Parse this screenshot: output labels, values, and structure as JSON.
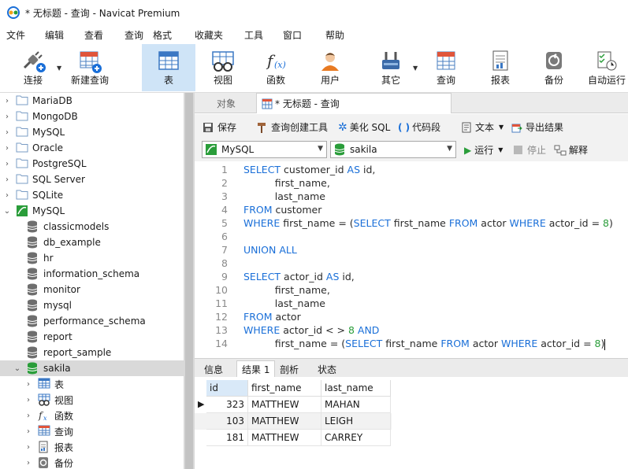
{
  "window": {
    "title": "* 无标题 - 查询 - Navicat Premium"
  },
  "menu": [
    "文件",
    "编辑",
    "查看",
    "查询",
    "格式",
    "收藏夹",
    "工具",
    "窗口",
    "帮助"
  ],
  "toolbar": {
    "items": [
      {
        "label": "连接",
        "icon": "connection-plug-icon"
      },
      {
        "label": "新建查询",
        "icon": "new-query-icon"
      },
      {
        "label": "表",
        "icon": "table-icon",
        "active": true
      },
      {
        "label": "视图",
        "icon": "view-icon"
      },
      {
        "label": "函数",
        "icon": "function-icon"
      },
      {
        "label": "用户",
        "icon": "user-icon"
      },
      {
        "label": "其它",
        "icon": "tools-icon"
      },
      {
        "label": "查询",
        "icon": "query-icon"
      },
      {
        "label": "报表",
        "icon": "report-icon"
      },
      {
        "label": "备份",
        "icon": "backup-icon"
      },
      {
        "label": "自动运行",
        "icon": "automation-icon"
      }
    ]
  },
  "sidebar": {
    "connections": [
      "MariaDB",
      "MongoDB",
      "MySQL",
      "Oracle",
      "PostgreSQL",
      "SQL Server",
      "SQLite"
    ],
    "open_connection": "MySQL",
    "databases": [
      "classicmodels",
      "db_example",
      "hr",
      "information_schema",
      "monitor",
      "mysql",
      "performance_schema",
      "report",
      "report_sample"
    ],
    "selected_db": "sakila",
    "children": [
      {
        "label": "表",
        "icon": "table-icon"
      },
      {
        "label": "视图",
        "icon": "view-icon"
      },
      {
        "label": "函数",
        "icon": "function-icon"
      },
      {
        "label": "查询",
        "icon": "query-icon"
      },
      {
        "label": "报表",
        "icon": "report-icon"
      },
      {
        "label": "备份",
        "icon": "backup-icon"
      }
    ]
  },
  "tabs": {
    "objects": "对象",
    "query": "* 无标题 - 查询"
  },
  "query_toolbar": {
    "save": "保存",
    "builder": "查询创建工具",
    "beautify": "美化 SQL",
    "snippet": "代码段",
    "text": "文本",
    "export": "导出结果",
    "run": "运行",
    "stop": "停止",
    "explain": "解释",
    "connection": "MySQL",
    "database": "sakila"
  },
  "editor": {
    "lines": [
      [
        {
          "t": "SELECT ",
          "k": "kw"
        },
        {
          "t": "customer_id ",
          "k": "id"
        },
        {
          "t": "AS ",
          "k": "kw"
        },
        {
          "t": "id,",
          "k": "id"
        }
      ],
      [
        {
          "t": "          first_name,",
          "k": "id"
        }
      ],
      [
        {
          "t": "          last_name",
          "k": "id"
        }
      ],
      [
        {
          "t": "FROM ",
          "k": "kw"
        },
        {
          "t": "customer",
          "k": "id"
        }
      ],
      [
        {
          "t": "WHERE ",
          "k": "kw"
        },
        {
          "t": "first_name = (",
          "k": "id"
        },
        {
          "t": "SELECT ",
          "k": "kw"
        },
        {
          "t": "first_name ",
          "k": "id"
        },
        {
          "t": "FROM ",
          "k": "kw"
        },
        {
          "t": "actor ",
          "k": "id"
        },
        {
          "t": "WHERE ",
          "k": "kw"
        },
        {
          "t": "actor_id = ",
          "k": "id"
        },
        {
          "t": "8",
          "k": "num"
        },
        {
          "t": ")",
          "k": "id"
        }
      ],
      [],
      [
        {
          "t": "UNION ALL",
          "k": "kw"
        }
      ],
      [],
      [
        {
          "t": "SELECT ",
          "k": "kw"
        },
        {
          "t": "actor_id ",
          "k": "id"
        },
        {
          "t": "AS ",
          "k": "kw"
        },
        {
          "t": "id,",
          "k": "id"
        }
      ],
      [
        {
          "t": "          first_name,",
          "k": "id"
        }
      ],
      [
        {
          "t": "          last_name",
          "k": "id"
        }
      ],
      [
        {
          "t": "FROM ",
          "k": "kw"
        },
        {
          "t": "actor",
          "k": "id"
        }
      ],
      [
        {
          "t": "WHERE ",
          "k": "kw"
        },
        {
          "t": "actor_id < > ",
          "k": "id"
        },
        {
          "t": "8 ",
          "k": "num"
        },
        {
          "t": "AND",
          "k": "kw"
        }
      ],
      [
        {
          "t": "          first_name = (",
          "k": "id"
        },
        {
          "t": "SELECT ",
          "k": "kw"
        },
        {
          "t": "first_name ",
          "k": "id"
        },
        {
          "t": "FROM ",
          "k": "kw"
        },
        {
          "t": "actor ",
          "k": "id"
        },
        {
          "t": "WHERE ",
          "k": "kw"
        },
        {
          "t": "actor_id = ",
          "k": "id"
        },
        {
          "t": "8",
          "k": "num"
        },
        {
          "t": ")",
          "k": "id"
        }
      ]
    ]
  },
  "result_tabs": [
    "信息",
    "结果 1",
    "剖析",
    "状态"
  ],
  "active_result_tab": 1,
  "results": {
    "columns": [
      "id",
      "first_name",
      "last_name"
    ],
    "rows": [
      [
        "323",
        "MATTHEW",
        "MAHAN"
      ],
      [
        "103",
        "MATTHEW",
        "LEIGH"
      ],
      [
        "181",
        "MATTHEW",
        "CARREY"
      ]
    ]
  },
  "colors": {
    "accent": "#1a6fd8",
    "number": "#2a9d3a",
    "active_tool": "#cfe4f7",
    "selection": "#d9d9d9"
  }
}
